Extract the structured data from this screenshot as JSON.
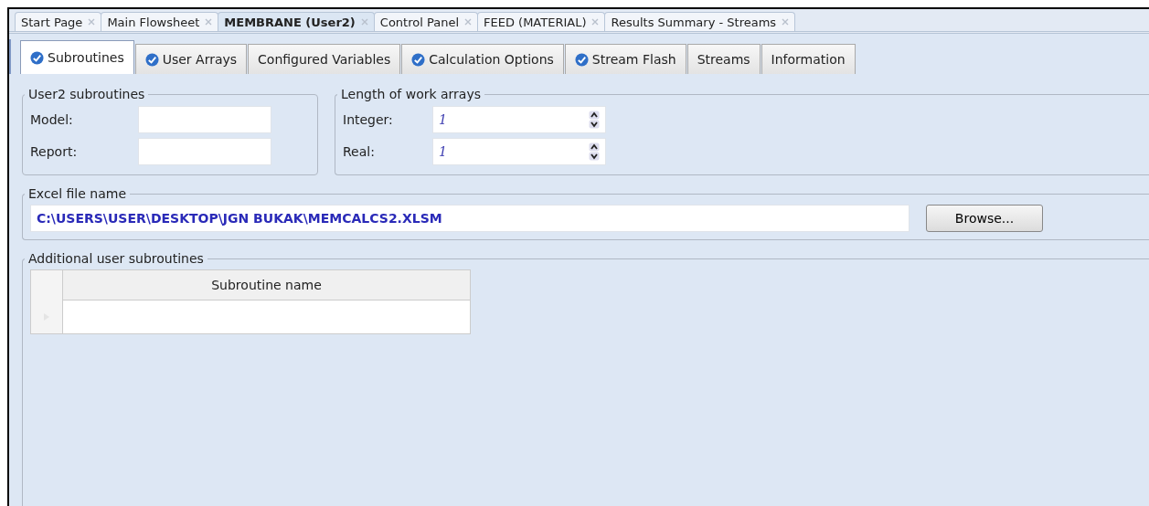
{
  "document_tabs": [
    {
      "label": "Start Page",
      "selected": false
    },
    {
      "label": "Main Flowsheet",
      "selected": false
    },
    {
      "label": "MEMBRANE (User2)",
      "selected": true
    },
    {
      "label": "Control Panel",
      "selected": false
    },
    {
      "label": "FEED (MATERIAL)",
      "selected": false
    },
    {
      "label": "Results Summary - Streams",
      "selected": false
    }
  ],
  "form_tabs": [
    {
      "label": "Subroutines",
      "selected": true,
      "complete": true
    },
    {
      "label": "User Arrays",
      "selected": false,
      "complete": true
    },
    {
      "label": "Configured Variables",
      "selected": false,
      "complete": false
    },
    {
      "label": "Calculation Options",
      "selected": false,
      "complete": true
    },
    {
      "label": "Stream Flash",
      "selected": false,
      "complete": true
    },
    {
      "label": "Streams",
      "selected": false,
      "complete": false
    },
    {
      "label": "Information",
      "selected": false,
      "complete": false
    }
  ],
  "user2_subroutines": {
    "title": "User2 subroutines",
    "fields": [
      {
        "label": "Model:"
      },
      {
        "label": "Report:"
      }
    ]
  },
  "work_arrays": {
    "title": "Length of work arrays",
    "fields": [
      {
        "label": "Integer:",
        "value": "1"
      },
      {
        "label": "Real:",
        "value": "1"
      }
    ]
  },
  "excel_file": {
    "title": "Excel file name",
    "value": "C:\\USERS\\USER\\DESKTOP\\JGN BUKAK\\MEMCALCS2.XLSM",
    "button": "Browse..."
  },
  "additional": {
    "title": "Additional user subroutines",
    "table": {
      "columns": [
        "Subroutine name"
      ]
    }
  }
}
